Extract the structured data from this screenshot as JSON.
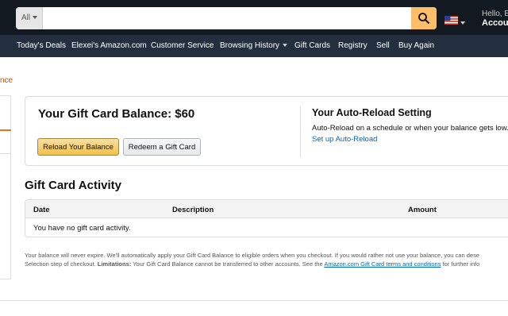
{
  "header": {
    "search_category": "All",
    "search_value": "",
    "hello_text": "Hello, El",
    "account_text": "Accoun"
  },
  "nav": {
    "items": [
      {
        "label": "Today's Deals"
      },
      {
        "label": "Elexei's Amazon.com"
      },
      {
        "label": "Customer Service"
      },
      {
        "label": "Browsing History"
      },
      {
        "label": "Gift Cards"
      },
      {
        "label": "Registry"
      },
      {
        "label": "Sell"
      },
      {
        "label": "Buy Again"
      }
    ]
  },
  "sidebar": {
    "link_fragment": "nce"
  },
  "balance": {
    "title": "Your Gift Card Balance: $60",
    "reload_button": "Reload Your Balance",
    "redeem_button": "Redeem a Gift Card"
  },
  "auto_reload": {
    "title": "Your Auto-Reload Setting",
    "description": "Auto-Reload on a schedule or when your balance gets low.",
    "link": "Set up Auto-Reload"
  },
  "activity": {
    "title": "Gift Card Activity",
    "columns": [
      "Date",
      "Description",
      "Amount"
    ],
    "empty_message": "You have no gift card activity."
  },
  "footnote": {
    "line1": "Your balance will never expire. We'll automatically apply your Gift Card Balance to eligible orders when you checkout. If you would rather not use your balance, you can dese",
    "line2_start": "Selection step of checkout.",
    "limitations_label": "Limitations:",
    "line2_middle": "Your Gift Card Balance cannot be transferred to other accounts. See the",
    "terms_link": "Amazon.com Gift Card terms and conditions",
    "line2_end": "for further info"
  },
  "colors": {
    "topbar": "#131921",
    "navbar": "#232f3e",
    "search_button": "#febd69",
    "primary_button": "#f0c14b",
    "link": "#0066c0",
    "orange_link": "#c45500"
  }
}
